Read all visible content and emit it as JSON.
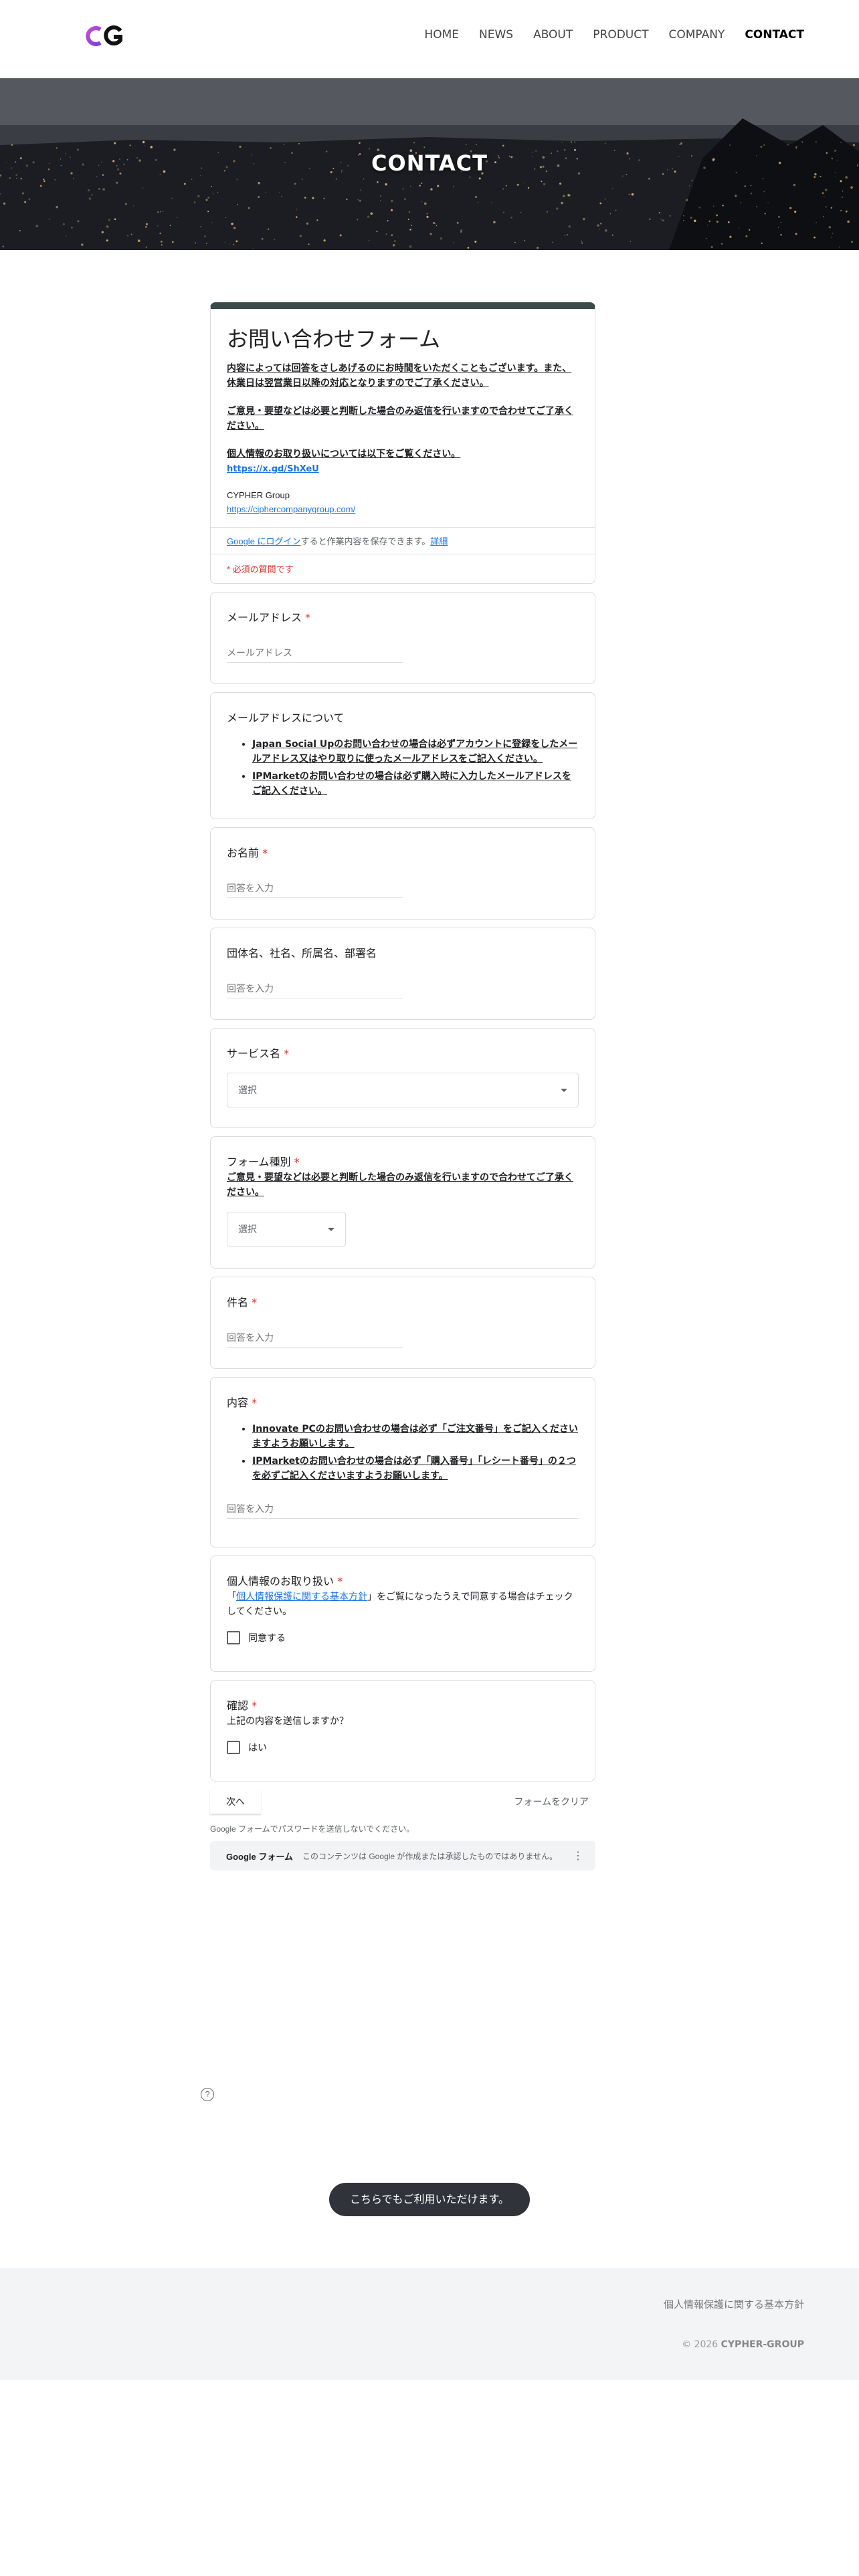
{
  "nav": {
    "items": [
      {
        "label": "HOME",
        "active": false
      },
      {
        "label": "NEWS",
        "active": false
      },
      {
        "label": "ABOUT",
        "active": false
      },
      {
        "label": "PRODUCT",
        "active": false
      },
      {
        "label": "COMPANY",
        "active": false
      },
      {
        "label": "CONTACT",
        "active": true
      }
    ]
  },
  "hero": {
    "title": "CONTACT"
  },
  "form": {
    "title": "お問い合わせフォーム",
    "description": [
      "内容によっては回答をさしあげるのにお時間をいただくこともございます。また、休業日は翌営業日以降の対応となりますのでご了承ください。",
      "ご意見・要望などは必要と判断した場合のみ返信を行いますので合わせてご了承ください。",
      "個人情報のお取り扱いについては以下をご覧ください。"
    ],
    "privacy_link": "https://x.gd/ShXeU",
    "company_name": "CYPHER Group",
    "company_url": "https://ciphercompanygroup.com/",
    "signin_link": "Google にログイン",
    "signin_text": "すると作業内容を保存できます。",
    "signin_detail": "詳細",
    "required_note": "* 必須の質問です",
    "questions": {
      "email": {
        "label": "メールアドレス",
        "placeholder": "メールアドレス"
      },
      "email_about": {
        "label": "メールアドレスについて",
        "bullets": [
          "Japan Social Upのお問い合わせの場合は必ずアカウントに登録をしたメールアドレス又はやり取りに使ったメールアドレスをご記入ください。",
          "IPMarketのお問い合わせの場合は必ず購入時に入力したメールアドレスをご記入ください。"
        ]
      },
      "name": {
        "label": "お名前",
        "placeholder": "回答を入力"
      },
      "org": {
        "label": "団体名、社名、所属名、部署名",
        "placeholder": "回答を入力"
      },
      "service": {
        "label": "サービス名",
        "select": "選択"
      },
      "form_type": {
        "label": "フォーム種別",
        "note": "ご意見・要望などは必要と判断した場合のみ返信を行いますので合わせてご了承ください。",
        "select": "選択"
      },
      "subject": {
        "label": "件名",
        "placeholder": "回答を入力"
      },
      "content": {
        "label": "内容",
        "bullets": [
          "Innovate PCのお問い合わせの場合は必ず「ご注文番号」をご記入くださいますようお願いします。",
          "IPMarketのお問い合わせの場合は必ず「購入番号」「レシート番号」の２つを必ずご記入くださいますようお願いします。"
        ],
        "placeholder": "回答を入力"
      },
      "privacy": {
        "label": "個人情報のお取り扱い",
        "text_pre": "「",
        "text_link": "個人情報保護に関する基本方針",
        "text_post": "」をご覧になったうえで同意する場合はチェックしてください。",
        "checkbox": "同意する"
      },
      "confirm": {
        "label": "確認",
        "text": "上記の内容を送信しますか？",
        "checkbox": "はい"
      }
    },
    "next_button": "次へ",
    "clear_button": "フォームをクリア",
    "password_note": "Google フォームでパスワードを送信しないでください。",
    "footer_brand": "Google フォーム",
    "footer_text": "このコンテンツは Google が作成または承認したものではありません。"
  },
  "help_icon": "?",
  "toast": "こちらでもご利用いただけます。",
  "site_footer": {
    "link": "個人情報保護に関する基本方針",
    "copyright_prefix": "© 2026 ",
    "copyright_brand": "CYPHER-GROUP"
  },
  "colors": {
    "accent": "#3a4a4b",
    "required": "#d93025",
    "link": "#1a73e8"
  }
}
